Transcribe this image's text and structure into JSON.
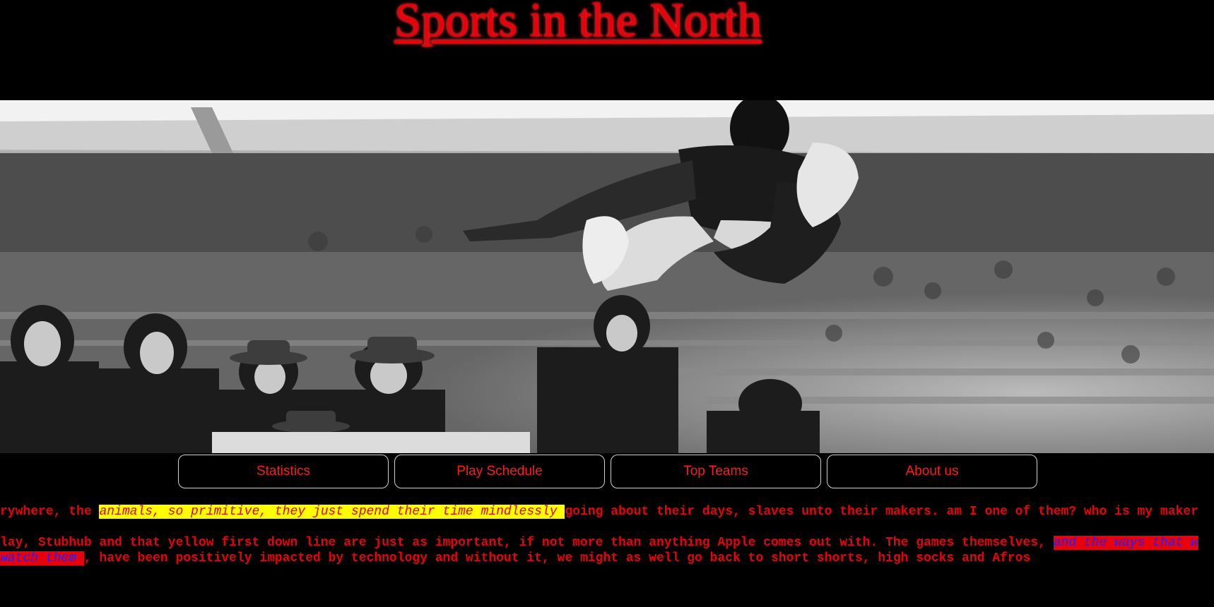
{
  "header": {
    "title": "Sports in the North"
  },
  "hero": {
    "image_icon": "long-jump-photo"
  },
  "nav": {
    "items": [
      {
        "label": "Statistics"
      },
      {
        "label": "Play Schedule"
      },
      {
        "label": "Top Teams"
      },
      {
        "label": "About us"
      }
    ]
  },
  "body_text": {
    "line1_pre": "rywhere, the ",
    "line1_highlight": "animals, so primitive, they just spend their time mindlessly ",
    "line1_post": "going about their days, slaves unto their makers. am I one of them? who is my maker",
    "line2_pre": "lay, Stubhub and that yellow first down line are just as important, if not more than anything Apple comes out with. The games themselves, ",
    "line2_highlight": "and the ways that w",
    "line3_highlight": " watch them ",
    "line3_post": ", have been positively impacted by technology and without it, we might as well go back to short shorts, high socks and Afros"
  },
  "colors": {
    "background": "#000000",
    "accent_red": "#e8000a",
    "highlight_yellow": "#ffff00",
    "highlight_blue_text": "#2020ff"
  }
}
